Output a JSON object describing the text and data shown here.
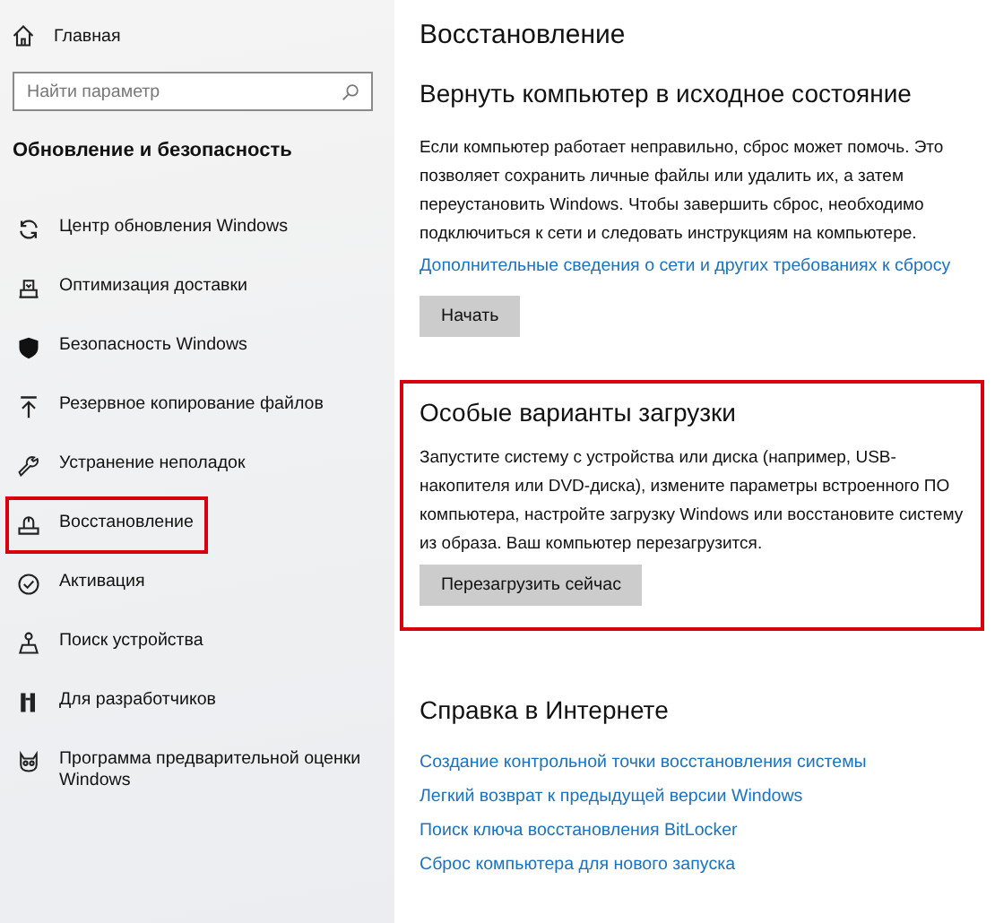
{
  "sidebar": {
    "home": "Главная",
    "search": {
      "placeholder": "Найти параметр"
    },
    "section_title": "Обновление и безопасность",
    "items": [
      {
        "label": "Центр обновления Windows",
        "selected": false
      },
      {
        "label": "Оптимизация доставки",
        "selected": false
      },
      {
        "label": "Безопасность Windows",
        "selected": false
      },
      {
        "label": "Резервное копирование файлов",
        "selected": false
      },
      {
        "label": "Устранение неполадок",
        "selected": false
      },
      {
        "label": "Восстановление",
        "selected": true
      },
      {
        "label": "Активация",
        "selected": false
      },
      {
        "label": "Поиск устройства",
        "selected": false
      },
      {
        "label": "Для разработчиков",
        "selected": false
      },
      {
        "label": "Программа предварительной оценки Windows",
        "selected": false
      }
    ]
  },
  "page_title": "Восстановление",
  "sections": [
    {
      "title": "Вернуть компьютер в исходное состояние",
      "highlighted": false,
      "text": [
        "Если компьютер работает неправильно, сброс может помочь. Это",
        "позволяет сохранить личные файлы или удалить их, а затем",
        "переустановить Windows. Чтобы завершить сброс, необходимо",
        "подключиться к сети и следовать инструкциям на компьютере."
      ],
      "link": "Дополнительные сведения о сети и других требованиях к сбросу",
      "button": "Начать"
    },
    {
      "title": "Особые варианты загрузки",
      "highlighted": true,
      "text": [
        "Запустите систему с устройства или диска (например, USB-",
        "накопителя или DVD-диска), измените параметры встроенного ПО",
        "компьютера, настройте загрузку Windows или восстановите систему",
        "из образа. Ваш компьютер перезагрузится."
      ],
      "button": "Перезагрузить сейчас"
    }
  ],
  "help": {
    "title": "Справка в Интернете",
    "links": [
      "Создание контрольной точки восстановления системы",
      "Легкий возврат к предыдущей версии Windows",
      "Поиск ключа восстановления BitLocker",
      "Сброс компьютера для нового запуска"
    ]
  }
}
